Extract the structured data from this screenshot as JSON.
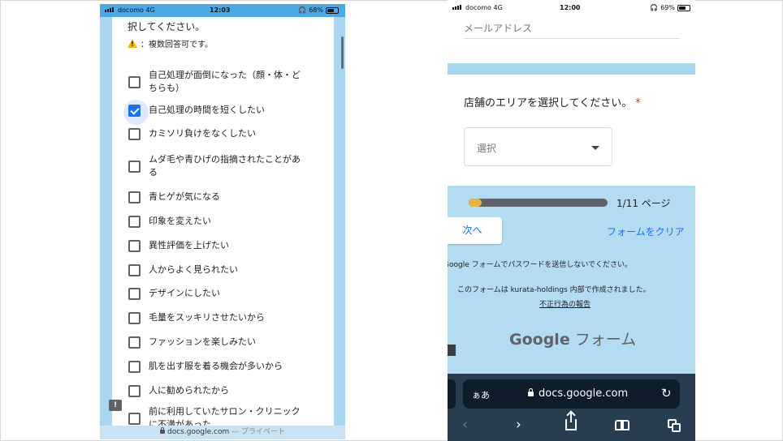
{
  "left_phone": {
    "status": {
      "carrier": "docomo  4G",
      "time": "12:03",
      "battery": "68%",
      "battery_level": 0.68
    },
    "question_tail": "択してください。",
    "note": "：複数回答可です。",
    "options": [
      {
        "label": "自己処理が面倒になった（顔・体・どちらも）",
        "checked": false
      },
      {
        "label": "自己処理の時間を短くしたい",
        "checked": true
      },
      {
        "label": "カミソリ負けをなくしたい",
        "checked": false
      },
      {
        "label": "ムダ毛や青ひげの指摘されたことがある",
        "checked": false
      },
      {
        "label": "青ヒゲが気になる",
        "checked": false
      },
      {
        "label": "印象を変えたい",
        "checked": false
      },
      {
        "label": "異性評価を上げたい",
        "checked": false
      },
      {
        "label": "人からよく見られたい",
        "checked": false
      },
      {
        "label": "デザインにしたい",
        "checked": false
      },
      {
        "label": "毛量をスッキリさせたいから",
        "checked": false
      },
      {
        "label": "ファッションを楽しみたい",
        "checked": false
      },
      {
        "label": "肌を出す服を着る機会が多いから",
        "checked": false
      },
      {
        "label": "人に勧められたから",
        "checked": false
      },
      {
        "label": "前に利用していたサロン・クリニックに不満があった",
        "checked": false
      }
    ],
    "url_bar": {
      "domain": "docs.google.com",
      "suffix": " — プライベート"
    }
  },
  "right_phone": {
    "status": {
      "carrier": "docomo  4G",
      "time": "12:00",
      "battery": "69%",
      "battery_level": 0.69
    },
    "email_placeholder": "メールアドレス",
    "area_question": "店舗のエリアを選択してください。",
    "required_mark": "*",
    "select_placeholder": "選択",
    "progress": {
      "text": "1/11 ページ",
      "fraction": 0.0909
    },
    "next_button": "次へ",
    "clear_link": "フォームをクリア",
    "password_warning": "Google フォームでパスワードを送信しないでください。",
    "made_in": "このフォームは kurata-holdings 内部で作成されました。",
    "abuse_link": "不正行為の報告",
    "brand_google": "Google",
    "brand_forms": " フォーム",
    "safari": {
      "text_size": "ぁあ",
      "domain": "docs.google.com"
    }
  },
  "colors": {
    "accent": "#1a73e8",
    "form_bg": "#a9d6f0",
    "progress": "#e8b33f",
    "safari_bar": "#283d4f"
  },
  "icons": [
    "signal-icon",
    "battery-icon",
    "warning-icon",
    "checkbox-icon",
    "feedback-icon",
    "lock-icon",
    "dropdown-caret-icon",
    "reload-icon",
    "back-icon",
    "forward-icon",
    "share-icon",
    "bookmarks-icon",
    "tabs-icon"
  ]
}
